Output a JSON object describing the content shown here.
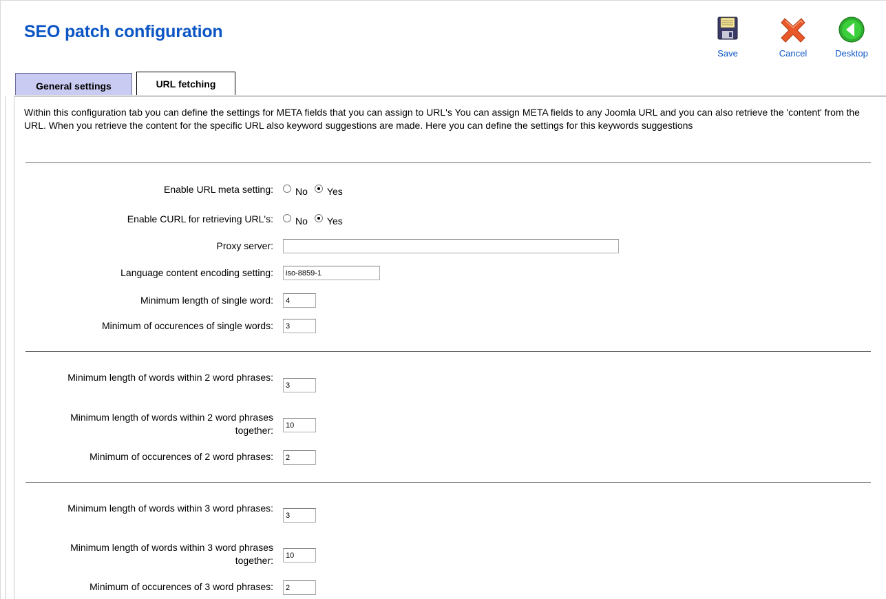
{
  "page": {
    "title": "SEO patch configuration"
  },
  "toolbar": {
    "save_label": "Save",
    "cancel_label": "Cancel",
    "desktop_label": "Desktop",
    "icons": {
      "save": "floppy-disk-icon",
      "cancel": "red-x-icon",
      "desktop": "green-back-arrow-icon"
    }
  },
  "tabs": [
    {
      "label": "General settings",
      "active": false
    },
    {
      "label": "URL fetching",
      "active": true
    }
  ],
  "description": "Within this configuration tab you can define the settings for META fields that you can assign to URL's You can assign META fields to any Joomla URL and you can also retrieve the 'content' from the URL. When you retrieve the content for the specific URL also keyword suggestions are made. Here you can define the settings for this keywords suggestions",
  "settings": {
    "enable_url_meta": {
      "label": "Enable URL meta setting:",
      "options": [
        "No",
        "Yes"
      ],
      "selected": "Yes"
    },
    "enable_curl": {
      "label": "Enable CURL for retrieving URL's:",
      "options": [
        "No",
        "Yes"
      ],
      "selected": "Yes"
    },
    "proxy_server": {
      "label": "Proxy server:",
      "value": ""
    },
    "encoding": {
      "label": "Language content encoding setting:",
      "value": "iso-8859-1"
    },
    "min_len_single": {
      "label": "Minimum length of single word:",
      "value": "4"
    },
    "min_occ_single": {
      "label": "Minimum of occurences of single words:",
      "value": "3"
    },
    "min_len_2word": {
      "label": "Minimum length of words within 2 word phrases:",
      "value": "3"
    },
    "min_len_2word_together": {
      "label": "Minimum length of words within 2 word phrases together:",
      "value": "10"
    },
    "min_occ_2word": {
      "label": "Minimum of occurences of 2 word phrases:",
      "value": "2"
    },
    "min_len_3word": {
      "label": "Minimum length of words within 3 word phrases:",
      "value": "3"
    },
    "min_len_3word_together": {
      "label": "Minimum length of words within 3 word phrases together:",
      "value": "10"
    },
    "min_occ_3word": {
      "label": "Minimum of occurences of 3 word phrases:",
      "value": "2"
    }
  },
  "colors": {
    "title": "#0b55c4",
    "active_tab_bg": "#c9cbf2",
    "link": "#0b55c4"
  }
}
